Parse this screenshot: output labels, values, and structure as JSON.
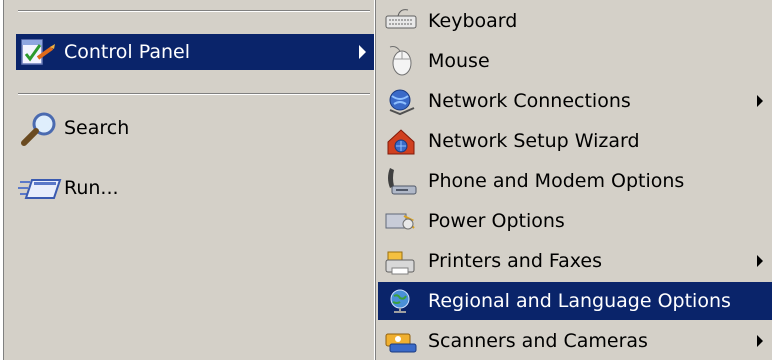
{
  "left_menu": {
    "items": [
      {
        "label": "Control Panel",
        "icon": "control-panel-icon",
        "active": true,
        "has_submenu": true
      },
      {
        "label": "Search",
        "icon": "search-magnifier-icon",
        "active": false,
        "has_submenu": false
      },
      {
        "label": "Run...",
        "icon": "run-icon",
        "active": false,
        "has_submenu": false
      }
    ]
  },
  "submenu": {
    "items": [
      {
        "label": "Keyboard",
        "icon": "keyboard-icon",
        "has_submenu": false,
        "active": false
      },
      {
        "label": "Mouse",
        "icon": "mouse-icon",
        "has_submenu": false,
        "active": false
      },
      {
        "label": "Network Connections",
        "icon": "network-connections-icon",
        "has_submenu": true,
        "active": false
      },
      {
        "label": "Network Setup Wizard",
        "icon": "network-setup-wizard-icon",
        "has_submenu": false,
        "active": false
      },
      {
        "label": "Phone and Modem Options",
        "icon": "phone-modem-icon",
        "has_submenu": false,
        "active": false
      },
      {
        "label": "Power Options",
        "icon": "power-options-icon",
        "has_submenu": false,
        "active": false
      },
      {
        "label": "Printers and Faxes",
        "icon": "printers-faxes-icon",
        "has_submenu": true,
        "active": false
      },
      {
        "label": "Regional and Language Options",
        "icon": "globe-icon",
        "has_submenu": false,
        "active": true
      },
      {
        "label": "Scanners and Cameras",
        "icon": "scanners-cameras-icon",
        "has_submenu": true,
        "active": false
      }
    ]
  },
  "colors": {
    "menu_bg": "#d4d0c8",
    "highlight_bg": "#0a246a",
    "highlight_text": "#ffffff"
  }
}
